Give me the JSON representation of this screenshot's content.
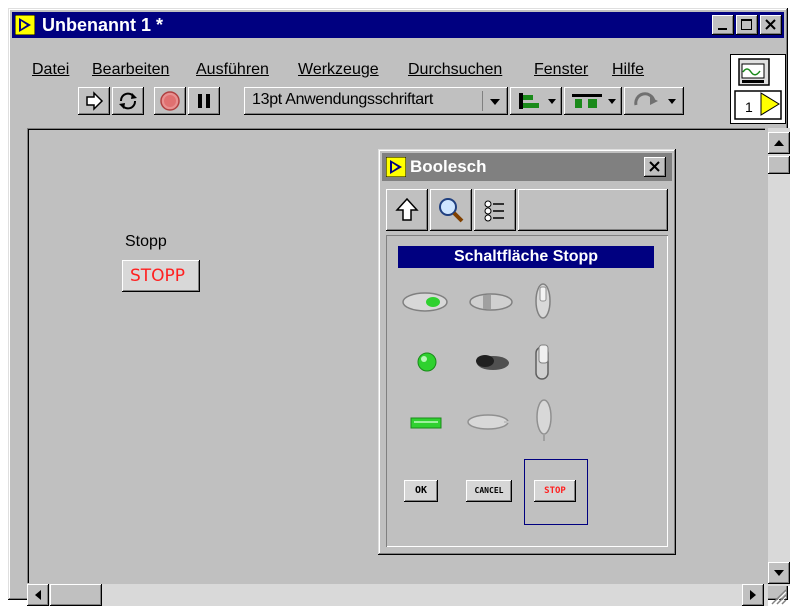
{
  "window": {
    "title": "Unbenannt 1 *",
    "minimize": "_",
    "maximize": "□",
    "close": "✕"
  },
  "menu": [
    {
      "label": "Datei"
    },
    {
      "label": "Bearbeiten"
    },
    {
      "label": "Ausführen"
    },
    {
      "label": "Werkzeuge"
    },
    {
      "label": "Durchsuchen"
    },
    {
      "label": "Fenster"
    },
    {
      "label": "Hilfe"
    }
  ],
  "toolbar": {
    "font": "13pt Anwendungsschriftart",
    "icons": [
      "run-arrow-icon",
      "run-continuously-icon",
      "abort-icon",
      "pause-icon",
      "align-icon",
      "distribute-icon",
      "reorder-icon"
    ]
  },
  "connector_pane": {
    "number": "1"
  },
  "front_panel": {
    "control_label": "Stopp",
    "control_text": "STOPP"
  },
  "palette": {
    "title": "Boolesch",
    "close": "✕",
    "selected_label": "Schaltfläche Stopp",
    "buttons": [
      "OK",
      "CANCEL",
      "STOP"
    ]
  },
  "colors": {
    "title_active": "#000080",
    "title_inactive": "#808080",
    "face": "#c0c0c0",
    "stop_text": "#ff2020",
    "led_green": "#2fd12f"
  }
}
